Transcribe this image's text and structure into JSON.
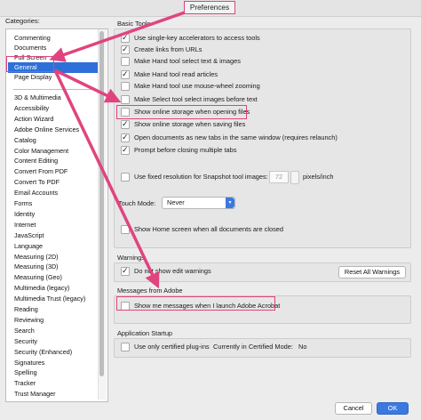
{
  "window": {
    "title": "Preferences"
  },
  "categories": {
    "label": "Categories:",
    "top_items": [
      {
        "label": "Commenting"
      },
      {
        "label": "Documents"
      },
      {
        "label": "Full Screen"
      },
      {
        "label": "General",
        "selected": true
      },
      {
        "label": "Page Display"
      }
    ],
    "items": [
      "3D & Multimedia",
      "Accessibility",
      "Action Wizard",
      "Adobe Online Services",
      "Catalog",
      "Color Management",
      "Content Editing",
      "Convert From PDF",
      "Convert To PDF",
      "Email Accounts",
      "Forms",
      "Identity",
      "Internet",
      "JavaScript",
      "Language",
      "Measuring (2D)",
      "Measuring (3D)",
      "Measuring (Geo)",
      "Multimedia (legacy)",
      "Multimedia Trust (legacy)",
      "Reading",
      "Reviewing",
      "Search",
      "Security",
      "Security (Enhanced)",
      "Signatures",
      "Spelling",
      "Tracker",
      "Trust Manager"
    ]
  },
  "basic_tools": {
    "title": "Basic Tools",
    "options": [
      {
        "label": "Use single-key accelerators to access tools",
        "checked": true
      },
      {
        "label": "Create links from URLs",
        "checked": true
      },
      {
        "label": "Make Hand tool select text & images",
        "checked": false
      },
      {
        "label": "Make Hand tool read articles",
        "checked": true
      },
      {
        "label": "Make Hand tool use mouse-wheel zooming",
        "checked": false
      },
      {
        "label": "Make Select tool select images before text",
        "checked": false
      },
      {
        "label": "Show online storage when opening files",
        "checked": false
      },
      {
        "label": "Show online storage when saving files",
        "checked": true
      },
      {
        "label": "Open documents as new tabs in the same window (requires relaunch)",
        "checked": true
      },
      {
        "label": "Prompt before closing multiple tabs",
        "checked": true
      }
    ],
    "fixed_resolution": {
      "label": "Use fixed resolution for Snapshot tool images:",
      "checked": false,
      "value": "72",
      "unit": "pixels/inch"
    },
    "touch_mode": {
      "label": "Touch Mode:",
      "value": "Never"
    },
    "home_screen": {
      "label": "Show Home screen when all documents are closed",
      "checked": false
    }
  },
  "warnings": {
    "title": "Warnings",
    "option": {
      "label": "Do not show edit warnings",
      "checked": true
    },
    "reset_button": "Reset All Warnings"
  },
  "messages": {
    "title": "Messages from Adobe",
    "option": {
      "label": "Show me messages when I launch Adobe Acrobat",
      "checked": false
    }
  },
  "startup": {
    "title": "Application Startup",
    "option": {
      "label": "Use only certified plug-ins",
      "checked": false
    },
    "certified_mode_label": "Currently in Certified Mode:",
    "certified_mode_value": "No"
  },
  "footer": {
    "cancel": "Cancel",
    "ok": "OK"
  },
  "colors": {
    "highlight": "#e0447e",
    "selection": "#2f6fd8",
    "accent": "#3a7ae0"
  }
}
